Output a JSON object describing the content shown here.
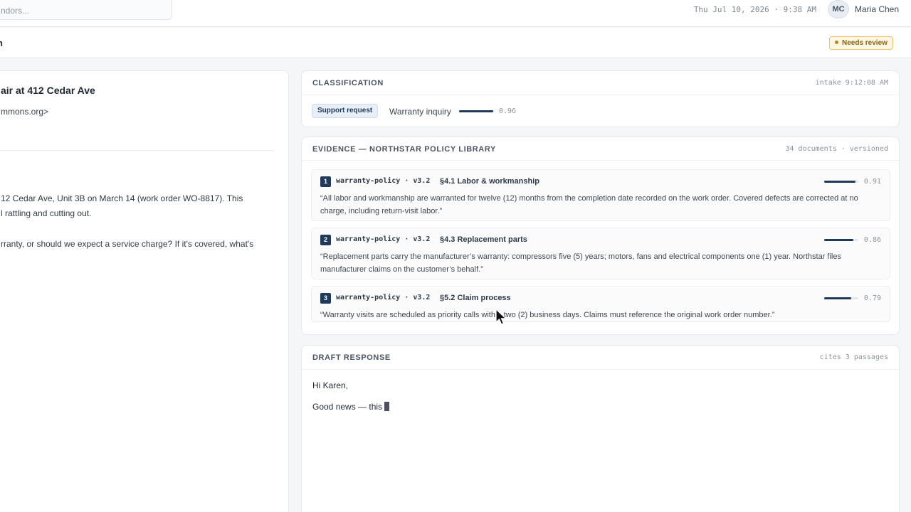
{
  "topbar": {
    "search_placeholder": "ndors...",
    "datetime": "Thu Jul 10, 2026 · 9:38 AM",
    "avatar_initials": "MC",
    "user_name": "Maria Chen"
  },
  "subheader": {
    "title": "n",
    "status_badge": "Needs review"
  },
  "email": {
    "subject": "air at 412 Cedar Ave",
    "from": "mmons.org>",
    "body": [
      "12 Cedar Ave, Unit 3B on March 14 (work order WO-8817). This",
      "l rattling and cutting out.",
      "rranty, or should we expect a service charge? If it's covered, what's"
    ]
  },
  "classification": {
    "title": "CLASSIFICATION",
    "meta": "intake 9:12:08 AM",
    "category": "Support request",
    "label": "Warranty inquiry",
    "confidence": 0.96,
    "confidence_text": "0.96"
  },
  "evidence": {
    "title": "EVIDENCE — NORTHSTAR POLICY LIBRARY",
    "meta": "34 documents · versioned",
    "passages": [
      {
        "num": "1",
        "doc": "warranty-policy · v3.2",
        "section": "§4.1 Labor & workmanship",
        "score": 0.91,
        "score_text": "0.91",
        "quote": "“All labor and workmanship are warranted for twelve (12) months from the completion date recorded on the work order. Covered defects are corrected at no charge, including return-visit labor.”"
      },
      {
        "num": "2",
        "doc": "warranty-policy · v3.2",
        "section": "§4.3 Replacement parts",
        "score": 0.86,
        "score_text": "0.86",
        "quote": "“Replacement parts carry the manufacturer’s warranty: compressors five (5) years; motors, fans and electrical components one (1) year. Northstar files manufacturer claims on the customer’s behalf.”"
      },
      {
        "num": "3",
        "doc": "warranty-policy · v3.2",
        "section": "§5.2 Claim process",
        "score": 0.79,
        "score_text": "0.79",
        "quote": "“Warranty visits are scheduled as priority calls within two (2) business days. Claims must reference the original work order number.”"
      }
    ]
  },
  "draft": {
    "title": "DRAFT RESPONSE",
    "meta": "cites 3 passages",
    "greeting": "Hi Karen,",
    "line": "Good news — this"
  },
  "colors": {
    "accent": "#1f3a5a",
    "badge_warning": "#b8860b"
  }
}
